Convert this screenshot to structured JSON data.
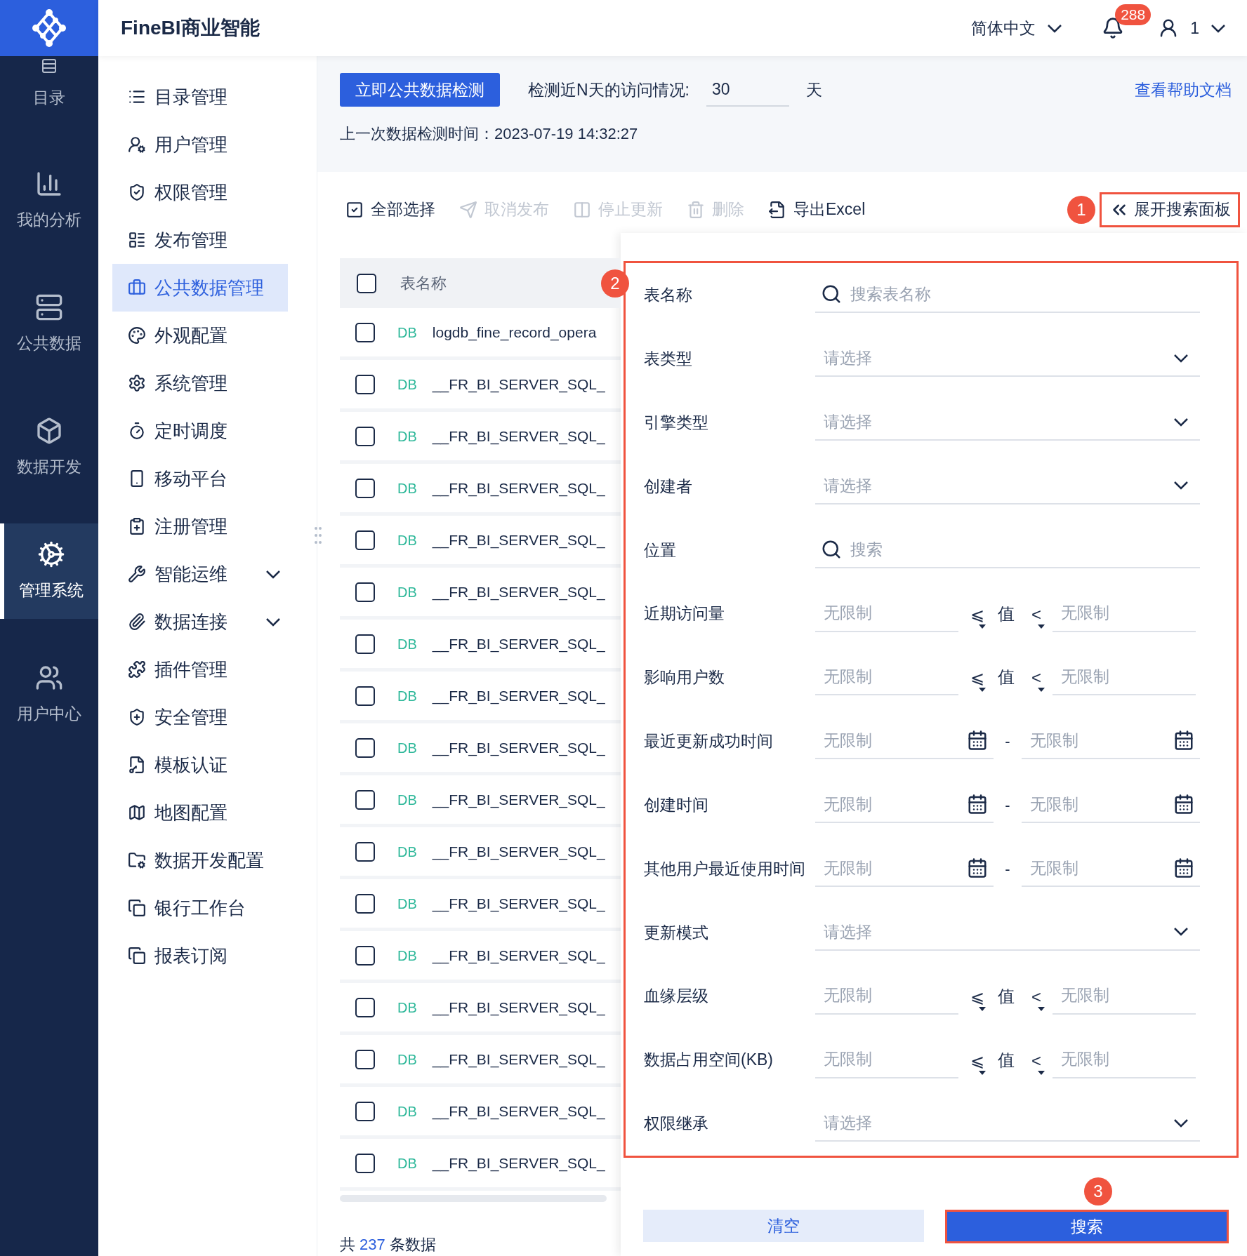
{
  "header": {
    "title": "FineBI商业智能",
    "language": "简体中文",
    "notification_count": "288",
    "user": "1"
  },
  "rail": [
    {
      "label": "目录",
      "selected": false
    },
    {
      "label": "我的分析",
      "selected": false
    },
    {
      "label": "公共数据",
      "selected": false
    },
    {
      "label": "数据开发",
      "selected": false
    },
    {
      "label": "管理系统",
      "selected": true
    },
    {
      "label": "用户中心",
      "selected": false
    }
  ],
  "menu": [
    {
      "label": "目录管理",
      "selected": false,
      "kind": "item"
    },
    {
      "label": "用户管理",
      "selected": false,
      "kind": "item"
    },
    {
      "label": "权限管理",
      "selected": false,
      "kind": "item"
    },
    {
      "label": "发布管理",
      "selected": false,
      "kind": "item"
    },
    {
      "label": "公共数据管理",
      "selected": true,
      "kind": "item"
    },
    {
      "label": "外观配置",
      "selected": false,
      "kind": "item"
    },
    {
      "label": "系统管理",
      "selected": false,
      "kind": "item"
    },
    {
      "label": "定时调度",
      "selected": false,
      "kind": "item"
    },
    {
      "label": "移动平台",
      "selected": false,
      "kind": "item"
    },
    {
      "label": "注册管理",
      "selected": false,
      "kind": "item"
    },
    {
      "label": "智能运维",
      "selected": false,
      "kind": "group"
    },
    {
      "label": "数据连接",
      "selected": false,
      "kind": "group"
    },
    {
      "label": "插件管理",
      "selected": false,
      "kind": "item"
    },
    {
      "label": "安全管理",
      "selected": false,
      "kind": "item"
    },
    {
      "label": "模板认证",
      "selected": false,
      "kind": "item"
    },
    {
      "label": "地图配置",
      "selected": false,
      "kind": "item"
    },
    {
      "label": "数据开发配置",
      "selected": false,
      "kind": "item"
    },
    {
      "label": "银行工作台",
      "selected": false,
      "kind": "item"
    },
    {
      "label": "报表订阅",
      "selected": false,
      "kind": "item"
    }
  ],
  "detect": {
    "button": "立即公共数据检测",
    "label": "检测近N天的访问情况:",
    "days_value": "30",
    "days_unit": "天",
    "help_link": "查看帮助文档",
    "last_check": "上一次数据检测时间：2023-07-19 14:32:27"
  },
  "toolbar": [
    {
      "label": "全部选择",
      "disabled": false
    },
    {
      "label": "取消发布",
      "disabled": true
    },
    {
      "label": "停止更新",
      "disabled": true
    },
    {
      "label": "删除",
      "disabled": true
    },
    {
      "label": "导出Excel",
      "disabled": false
    }
  ],
  "expand_button": {
    "label": "展开搜索面板",
    "highlighted": true,
    "callout": "1"
  },
  "table": {
    "columns": [
      "表名称"
    ],
    "header_checked": false,
    "callout": "2",
    "rows": [
      {
        "type": "DB",
        "name": "logdb_fine_record_opera",
        "checked": false
      },
      {
        "type": "DB",
        "name": "__FR_BI_SERVER_SQL_",
        "checked": false
      },
      {
        "type": "DB",
        "name": "__FR_BI_SERVER_SQL_",
        "checked": false
      },
      {
        "type": "DB",
        "name": "__FR_BI_SERVER_SQL_",
        "checked": false
      },
      {
        "type": "DB",
        "name": "__FR_BI_SERVER_SQL_",
        "checked": false
      },
      {
        "type": "DB",
        "name": "__FR_BI_SERVER_SQL_",
        "checked": false
      },
      {
        "type": "DB",
        "name": "__FR_BI_SERVER_SQL_",
        "checked": false
      },
      {
        "type": "DB",
        "name": "__FR_BI_SERVER_SQL_",
        "checked": false
      },
      {
        "type": "DB",
        "name": "__FR_BI_SERVER_SQL_",
        "checked": false
      },
      {
        "type": "DB",
        "name": "__FR_BI_SERVER_SQL_",
        "checked": false
      },
      {
        "type": "DB",
        "name": "__FR_BI_SERVER_SQL_",
        "checked": false
      },
      {
        "type": "DB",
        "name": "__FR_BI_SERVER_SQL_",
        "checked": false
      },
      {
        "type": "DB",
        "name": "__FR_BI_SERVER_SQL_",
        "checked": false
      },
      {
        "type": "DB",
        "name": "__FR_BI_SERVER_SQL_",
        "checked": false
      },
      {
        "type": "DB",
        "name": "__FR_BI_SERVER_SQL_",
        "checked": false
      },
      {
        "type": "DB",
        "name": "__FR_BI_SERVER_SQL_",
        "checked": false
      },
      {
        "type": "DB",
        "name": "__FR_BI_SERVER_SQL_",
        "checked": false
      }
    ]
  },
  "total": {
    "prefix": "共",
    "count": "237",
    "suffix": "条数据"
  },
  "search_panel": {
    "highlighted": true,
    "fields": [
      {
        "kind": "text",
        "label": "表名称",
        "placeholder": "搜索表名称"
      },
      {
        "kind": "select",
        "label": "表类型",
        "placeholder": "请选择"
      },
      {
        "kind": "select",
        "label": "引擎类型",
        "placeholder": "请选择"
      },
      {
        "kind": "select",
        "label": "创建者",
        "placeholder": "请选择"
      },
      {
        "kind": "text",
        "label": "位置",
        "placeholder": "搜索"
      },
      {
        "kind": "range",
        "label": "近期访问量",
        "min_placeholder": "无限制",
        "min_op": "⩽",
        "value_label": "值",
        "max_op": "<",
        "max_placeholder": "无限制"
      },
      {
        "kind": "range",
        "label": "影响用户数",
        "min_placeholder": "无限制",
        "min_op": "⩽",
        "value_label": "值",
        "max_op": "<",
        "max_placeholder": "无限制"
      },
      {
        "kind": "date",
        "label": "最近更新成功时间",
        "from_placeholder": "无限制",
        "separator": "-",
        "to_placeholder": "无限制"
      },
      {
        "kind": "date",
        "label": "创建时间",
        "from_placeholder": "无限制",
        "separator": "-",
        "to_placeholder": "无限制"
      },
      {
        "kind": "date",
        "label": "其他用户最近使用时间",
        "from_placeholder": "无限制",
        "separator": "-",
        "to_placeholder": "无限制"
      },
      {
        "kind": "select",
        "label": "更新模式",
        "placeholder": "请选择"
      },
      {
        "kind": "range",
        "label": "血缘层级",
        "min_placeholder": "无限制",
        "min_op": "⩽",
        "value_label": "值",
        "max_op": "<",
        "max_placeholder": "无限制"
      },
      {
        "kind": "range",
        "label": "数据占用空间(KB)",
        "min_placeholder": "无限制",
        "min_op": "⩽",
        "value_label": "值",
        "max_op": "<",
        "max_placeholder": "无限制"
      },
      {
        "kind": "select",
        "label": "权限继承",
        "placeholder": "请选择"
      }
    ],
    "clear_button": {
      "label": "清空"
    },
    "search_button": {
      "label": "搜索",
      "highlighted": true,
      "callout": "3"
    }
  }
}
